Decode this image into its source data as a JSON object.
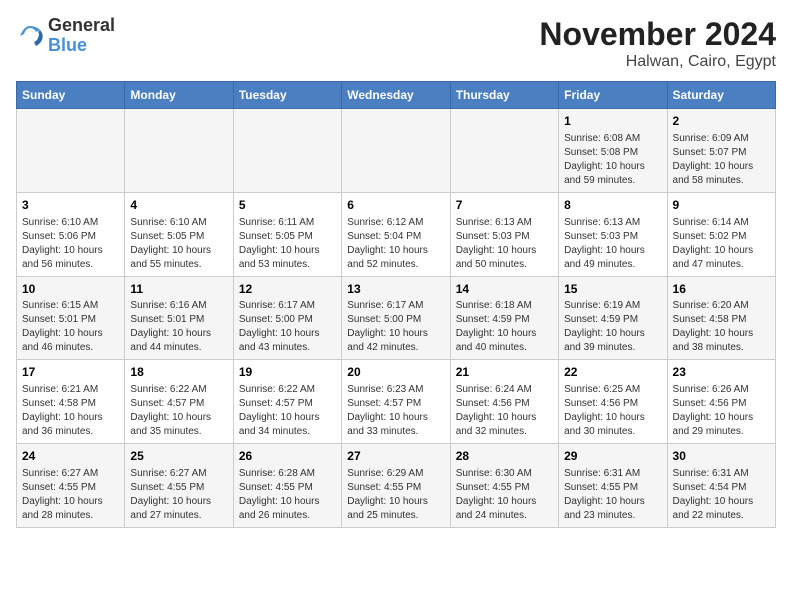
{
  "header": {
    "logo_line1": "General",
    "logo_line2": "Blue",
    "month_title": "November 2024",
    "subtitle": "Halwan, Cairo, Egypt"
  },
  "weekdays": [
    "Sunday",
    "Monday",
    "Tuesday",
    "Wednesday",
    "Thursday",
    "Friday",
    "Saturday"
  ],
  "weeks": [
    [
      {
        "day": "",
        "info": ""
      },
      {
        "day": "",
        "info": ""
      },
      {
        "day": "",
        "info": ""
      },
      {
        "day": "",
        "info": ""
      },
      {
        "day": "",
        "info": ""
      },
      {
        "day": "1",
        "info": "Sunrise: 6:08 AM\nSunset: 5:08 PM\nDaylight: 10 hours and 59 minutes."
      },
      {
        "day": "2",
        "info": "Sunrise: 6:09 AM\nSunset: 5:07 PM\nDaylight: 10 hours and 58 minutes."
      }
    ],
    [
      {
        "day": "3",
        "info": "Sunrise: 6:10 AM\nSunset: 5:06 PM\nDaylight: 10 hours and 56 minutes."
      },
      {
        "day": "4",
        "info": "Sunrise: 6:10 AM\nSunset: 5:05 PM\nDaylight: 10 hours and 55 minutes."
      },
      {
        "day": "5",
        "info": "Sunrise: 6:11 AM\nSunset: 5:05 PM\nDaylight: 10 hours and 53 minutes."
      },
      {
        "day": "6",
        "info": "Sunrise: 6:12 AM\nSunset: 5:04 PM\nDaylight: 10 hours and 52 minutes."
      },
      {
        "day": "7",
        "info": "Sunrise: 6:13 AM\nSunset: 5:03 PM\nDaylight: 10 hours and 50 minutes."
      },
      {
        "day": "8",
        "info": "Sunrise: 6:13 AM\nSunset: 5:03 PM\nDaylight: 10 hours and 49 minutes."
      },
      {
        "day": "9",
        "info": "Sunrise: 6:14 AM\nSunset: 5:02 PM\nDaylight: 10 hours and 47 minutes."
      }
    ],
    [
      {
        "day": "10",
        "info": "Sunrise: 6:15 AM\nSunset: 5:01 PM\nDaylight: 10 hours and 46 minutes."
      },
      {
        "day": "11",
        "info": "Sunrise: 6:16 AM\nSunset: 5:01 PM\nDaylight: 10 hours and 44 minutes."
      },
      {
        "day": "12",
        "info": "Sunrise: 6:17 AM\nSunset: 5:00 PM\nDaylight: 10 hours and 43 minutes."
      },
      {
        "day": "13",
        "info": "Sunrise: 6:17 AM\nSunset: 5:00 PM\nDaylight: 10 hours and 42 minutes."
      },
      {
        "day": "14",
        "info": "Sunrise: 6:18 AM\nSunset: 4:59 PM\nDaylight: 10 hours and 40 minutes."
      },
      {
        "day": "15",
        "info": "Sunrise: 6:19 AM\nSunset: 4:59 PM\nDaylight: 10 hours and 39 minutes."
      },
      {
        "day": "16",
        "info": "Sunrise: 6:20 AM\nSunset: 4:58 PM\nDaylight: 10 hours and 38 minutes."
      }
    ],
    [
      {
        "day": "17",
        "info": "Sunrise: 6:21 AM\nSunset: 4:58 PM\nDaylight: 10 hours and 36 minutes."
      },
      {
        "day": "18",
        "info": "Sunrise: 6:22 AM\nSunset: 4:57 PM\nDaylight: 10 hours and 35 minutes."
      },
      {
        "day": "19",
        "info": "Sunrise: 6:22 AM\nSunset: 4:57 PM\nDaylight: 10 hours and 34 minutes."
      },
      {
        "day": "20",
        "info": "Sunrise: 6:23 AM\nSunset: 4:57 PM\nDaylight: 10 hours and 33 minutes."
      },
      {
        "day": "21",
        "info": "Sunrise: 6:24 AM\nSunset: 4:56 PM\nDaylight: 10 hours and 32 minutes."
      },
      {
        "day": "22",
        "info": "Sunrise: 6:25 AM\nSunset: 4:56 PM\nDaylight: 10 hours and 30 minutes."
      },
      {
        "day": "23",
        "info": "Sunrise: 6:26 AM\nSunset: 4:56 PM\nDaylight: 10 hours and 29 minutes."
      }
    ],
    [
      {
        "day": "24",
        "info": "Sunrise: 6:27 AM\nSunset: 4:55 PM\nDaylight: 10 hours and 28 minutes."
      },
      {
        "day": "25",
        "info": "Sunrise: 6:27 AM\nSunset: 4:55 PM\nDaylight: 10 hours and 27 minutes."
      },
      {
        "day": "26",
        "info": "Sunrise: 6:28 AM\nSunset: 4:55 PM\nDaylight: 10 hours and 26 minutes."
      },
      {
        "day": "27",
        "info": "Sunrise: 6:29 AM\nSunset: 4:55 PM\nDaylight: 10 hours and 25 minutes."
      },
      {
        "day": "28",
        "info": "Sunrise: 6:30 AM\nSunset: 4:55 PM\nDaylight: 10 hours and 24 minutes."
      },
      {
        "day": "29",
        "info": "Sunrise: 6:31 AM\nSunset: 4:55 PM\nDaylight: 10 hours and 23 minutes."
      },
      {
        "day": "30",
        "info": "Sunrise: 6:31 AM\nSunset: 4:54 PM\nDaylight: 10 hours and 22 minutes."
      }
    ]
  ]
}
